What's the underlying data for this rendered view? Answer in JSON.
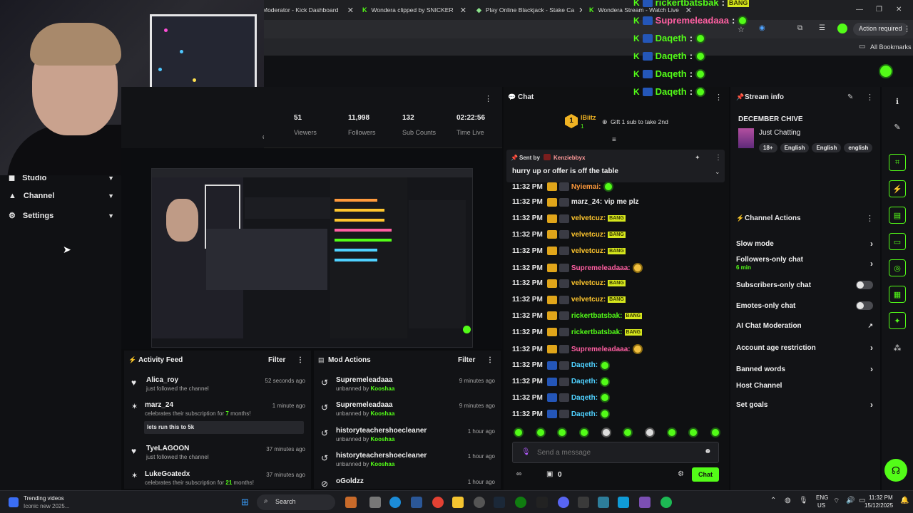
{
  "browser": {
    "tabs": [
      {
        "label": "Moderator - Kick Dashboard"
      },
      {
        "label": "Wondera clipped by SNICKER"
      },
      {
        "label": "Play Online Blackjack - Stake Ca"
      },
      {
        "label": "Wondera Stream - Watch Live"
      }
    ],
    "action_required": "Action required",
    "all_bookmarks": "All Bookmarks"
  },
  "overlay_chat": [
    {
      "user": "rickertbatsbak",
      "msg": "BANG"
    },
    {
      "user": "Supremeleadaaa",
      "msg": ""
    },
    {
      "user": "Daqeth",
      "msg": ""
    },
    {
      "user": "Daqeth",
      "msg": ""
    },
    {
      "user": "Daqeth",
      "msg": ""
    },
    {
      "user": "Daqeth",
      "msg": ""
    }
  ],
  "sidebar": {
    "items": [
      {
        "label": "Studio"
      },
      {
        "label": "Channel"
      },
      {
        "label": "Settings"
      }
    ]
  },
  "stats": {
    "partial_label": "eam",
    "items": [
      {
        "value": "51",
        "label": "Viewers"
      },
      {
        "value": "11,998",
        "label": "Followers"
      },
      {
        "value": "132",
        "label": "Sub Counts"
      },
      {
        "value": "02:22:56",
        "label": "Time Live"
      }
    ]
  },
  "activity_feed": {
    "title": "Activity Feed",
    "filter": "Filter",
    "items": [
      {
        "name": "Alica_roy",
        "sub": "just followed the channel",
        "time": "52 seconds ago"
      },
      {
        "name": "marz_24",
        "sub_pre": "celebrates their subscription for ",
        "sub_num": "7",
        "sub_post": " months!",
        "time": "1 minute ago",
        "message": "lets run this to 5k"
      },
      {
        "name": "TyeLAGOON",
        "sub": "just followed the channel",
        "time": "37 minutes ago"
      },
      {
        "name": "LukeGoatedx",
        "sub_pre": "celebrates their subscription for ",
        "sub_num": "21",
        "sub_post": " months!",
        "time": "37 minutes ago"
      }
    ]
  },
  "mod_actions": {
    "title": "Mod Actions",
    "filter": "Filter",
    "items": [
      {
        "name": "Supremeleadaaa",
        "sub": "unbanned by ",
        "mod": "Kooshaa",
        "time": "9 minutes ago"
      },
      {
        "name": "Supremeleadaaa",
        "sub": "unbanned by ",
        "mod": "Kooshaa",
        "time": "9 minutes ago"
      },
      {
        "name": "historyteachershoecleaner",
        "sub": "unbanned by ",
        "mod": "Kooshaa",
        "time": "1 hour ago"
      },
      {
        "name": "historyteachershoecleaner",
        "sub": "unbanned by ",
        "mod": "Kooshaa",
        "time": "1 hour ago"
      },
      {
        "name": "oGoldzz",
        "time": "1 hour ago"
      }
    ]
  },
  "chat": {
    "title": "Chat",
    "gifter": "lBiitz",
    "gifter_rank": "1",
    "gifter_count": "1",
    "gift_prompt": "Gift 1 sub to take 2nd",
    "pinned_sent_by": "Sent by",
    "pinned_user": "Kenziebbyx",
    "pinned_message": "hurry up or offer is off the table",
    "messages": [
      {
        "time": "11:32 PM",
        "user": "Nyiemai:",
        "color": "#ff9a3c",
        "text": ""
      },
      {
        "time": "11:32 PM",
        "user": "marz_24:",
        "color": "#e8e8e8",
        "text": "vip me plz"
      },
      {
        "time": "11:32 PM",
        "user": "velvetcuz:",
        "color": "#ffc62e",
        "text": "BANG"
      },
      {
        "time": "11:32 PM",
        "user": "velvetcuz:",
        "color": "#ffc62e",
        "text": "BANG"
      },
      {
        "time": "11:32 PM",
        "user": "velvetcuz:",
        "color": "#ffc62e",
        "text": "BANG"
      },
      {
        "time": "11:32 PM",
        "user": "Supremeleadaaa:",
        "color": "#ff5fa2",
        "text": ""
      },
      {
        "time": "11:32 PM",
        "user": "velvetcuz:",
        "color": "#ffc62e",
        "text": "BANG"
      },
      {
        "time": "11:32 PM",
        "user": "velvetcuz:",
        "color": "#ffc62e",
        "text": "BANG"
      },
      {
        "time": "11:32 PM",
        "user": "rickertbatsbak:",
        "color": "#53fc18",
        "text": "BANG"
      },
      {
        "time": "11:32 PM",
        "user": "rickertbatsbak:",
        "color": "#53fc18",
        "text": "BANG"
      },
      {
        "time": "11:32 PM",
        "user": "Supremeleadaaa:",
        "color": "#ff5fa2",
        "text": ""
      },
      {
        "time": "11:32 PM",
        "user": "Daqeth:",
        "color": "#4fd1ff",
        "text": ""
      },
      {
        "time": "11:32 PM",
        "user": "Daqeth:",
        "color": "#4fd1ff",
        "text": ""
      },
      {
        "time": "11:32 PM",
        "user": "Daqeth:",
        "color": "#4fd1ff",
        "text": ""
      },
      {
        "time": "11:32 PM",
        "user": "Daqeth:",
        "color": "#4fd1ff",
        "text": ""
      }
    ],
    "input_placeholder": "Send a message",
    "points": "0",
    "send_label": "Chat"
  },
  "stream_info": {
    "title": "Stream info",
    "stream_title": "DECEMBER CHIVE",
    "category": "Just Chatting",
    "tags": [
      "18+",
      "English",
      "English",
      "english"
    ]
  },
  "channel_actions": {
    "title": "Channel Actions",
    "items": [
      {
        "label": "Slow mode",
        "control": "arrow"
      },
      {
        "label": "Followers-only chat",
        "sub": "6 min",
        "control": "arrow"
      },
      {
        "label": "Subscribers-only chat",
        "control": "toggle"
      },
      {
        "label": "Emotes-only chat",
        "control": "toggle"
      },
      {
        "label": "AI Chat Moderation",
        "control": "external"
      },
      {
        "label": "Account age restriction",
        "control": "arrow"
      },
      {
        "label": "Banned words",
        "control": "arrow"
      },
      {
        "label": "Host Channel",
        "control": "none"
      },
      {
        "label": "Set goals",
        "control": "arrow"
      }
    ]
  },
  "taskbar": {
    "widget_title": "Trending videos",
    "widget_sub": "Iconic new 2025...",
    "search": "Search",
    "lang": "ENG",
    "region": "US",
    "time": "11:32 PM",
    "date": "15/12/2025"
  },
  "colors": {
    "kick_green": "#53fc18",
    "panel": "#121316",
    "background": "#0b0c0e"
  }
}
